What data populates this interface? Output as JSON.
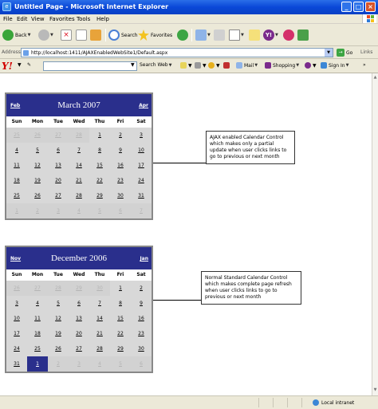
{
  "window": {
    "title": "Untitled Page - Microsoft Internet Explorer"
  },
  "menu": [
    "File",
    "Edit",
    "View",
    "Favorites",
    "Tools",
    "Help"
  ],
  "toolbar": {
    "back": "Back",
    "search": "Search",
    "favorites": "Favorites"
  },
  "address": {
    "label": "Address",
    "url": "http://localhost:1411/AJAXEnabledWebSite1/Default.aspx",
    "go": "Go",
    "links": "Links"
  },
  "yahoo": {
    "search_web": "Search Web",
    "mail": "Mail",
    "shopping": "Shopping",
    "sign_in": "Sign In"
  },
  "calendar1": {
    "prev": "Feb",
    "title": "March 2007",
    "next": "Apr",
    "dow": [
      "Sun",
      "Mon",
      "Tue",
      "Wed",
      "Thu",
      "Fri",
      "Sat"
    ],
    "weeks": [
      [
        {
          "d": "25",
          "o": true
        },
        {
          "d": "26",
          "o": true
        },
        {
          "d": "27",
          "o": true
        },
        {
          "d": "28",
          "o": true
        },
        {
          "d": "1"
        },
        {
          "d": "2"
        },
        {
          "d": "3"
        }
      ],
      [
        {
          "d": "4"
        },
        {
          "d": "5"
        },
        {
          "d": "6"
        },
        {
          "d": "7"
        },
        {
          "d": "8"
        },
        {
          "d": "9"
        },
        {
          "d": "10"
        }
      ],
      [
        {
          "d": "11"
        },
        {
          "d": "12"
        },
        {
          "d": "13"
        },
        {
          "d": "14"
        },
        {
          "d": "15"
        },
        {
          "d": "16"
        },
        {
          "d": "17"
        }
      ],
      [
        {
          "d": "18"
        },
        {
          "d": "19"
        },
        {
          "d": "20"
        },
        {
          "d": "21"
        },
        {
          "d": "22"
        },
        {
          "d": "23"
        },
        {
          "d": "24"
        }
      ],
      [
        {
          "d": "25"
        },
        {
          "d": "26"
        },
        {
          "d": "27"
        },
        {
          "d": "28"
        },
        {
          "d": "29"
        },
        {
          "d": "30"
        },
        {
          "d": "31"
        }
      ],
      [
        {
          "d": "1",
          "o": true
        },
        {
          "d": "2",
          "o": true
        },
        {
          "d": "3",
          "o": true
        },
        {
          "d": "4",
          "o": true
        },
        {
          "d": "5",
          "o": true
        },
        {
          "d": "6",
          "o": true
        },
        {
          "d": "7",
          "o": true
        }
      ]
    ],
    "note": "AJAX enabled Calendar Control which makes only a partial update when user clicks links to go to previous or next month"
  },
  "calendar2": {
    "prev": "Nov",
    "title": "December 2006",
    "next": "Jan",
    "dow": [
      "Sun",
      "Mon",
      "Tue",
      "Wed",
      "Thu",
      "Fri",
      "Sat"
    ],
    "weeks": [
      [
        {
          "d": "26",
          "o": true
        },
        {
          "d": "27",
          "o": true
        },
        {
          "d": "28",
          "o": true
        },
        {
          "d": "29",
          "o": true
        },
        {
          "d": "30",
          "o": true
        },
        {
          "d": "1"
        },
        {
          "d": "2"
        }
      ],
      [
        {
          "d": "3"
        },
        {
          "d": "4"
        },
        {
          "d": "5"
        },
        {
          "d": "6"
        },
        {
          "d": "7"
        },
        {
          "d": "8"
        },
        {
          "d": "9"
        }
      ],
      [
        {
          "d": "10"
        },
        {
          "d": "11"
        },
        {
          "d": "12"
        },
        {
          "d": "13"
        },
        {
          "d": "14"
        },
        {
          "d": "15"
        },
        {
          "d": "16"
        }
      ],
      [
        {
          "d": "17"
        },
        {
          "d": "18"
        },
        {
          "d": "19"
        },
        {
          "d": "20"
        },
        {
          "d": "21"
        },
        {
          "d": "22"
        },
        {
          "d": "23"
        }
      ],
      [
        {
          "d": "24"
        },
        {
          "d": "25"
        },
        {
          "d": "26"
        },
        {
          "d": "27"
        },
        {
          "d": "28"
        },
        {
          "d": "29"
        },
        {
          "d": "30"
        }
      ],
      [
        {
          "d": "31"
        },
        {
          "d": "1",
          "o": true,
          "sel": true
        },
        {
          "d": "2",
          "o": true
        },
        {
          "d": "3",
          "o": true
        },
        {
          "d": "4",
          "o": true
        },
        {
          "d": "5",
          "o": true
        },
        {
          "d": "6",
          "o": true
        }
      ]
    ],
    "note": "Normal Standard Calendar Control which makes complete page refresh when user clicks links to go to previous or next month"
  },
  "status": {
    "zone": "Local intranet"
  },
  "colors": {
    "calendar_header": "#2a2f8c",
    "title_bar": "#0a48d8"
  }
}
